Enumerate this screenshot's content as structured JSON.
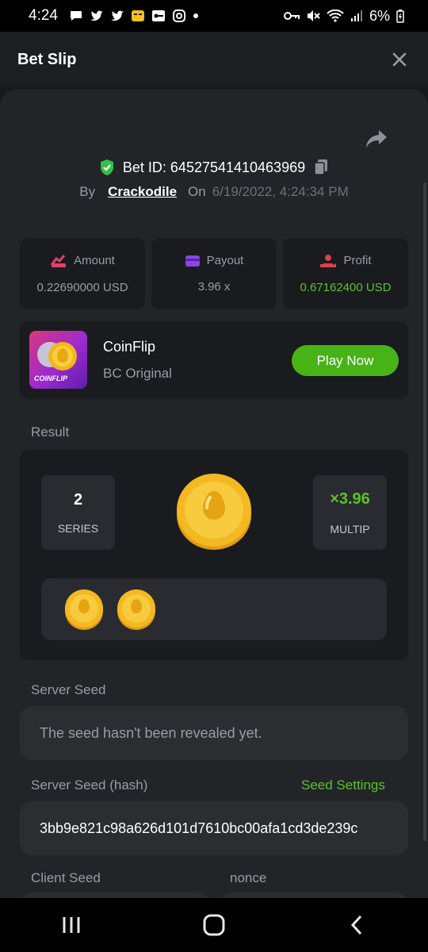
{
  "status_bar": {
    "time": "4:24",
    "battery": "6%"
  },
  "header": {
    "title": "Bet Slip"
  },
  "bet": {
    "id_label": "Bet ID:",
    "id": "64527541410463969",
    "by_label": "By",
    "user": "Crackodile",
    "on_label": "On",
    "datetime": "6/19/2022, 4:24:34 PM"
  },
  "stats": {
    "amount": {
      "label": "Amount",
      "value": "0.22690000 USD"
    },
    "payout": {
      "label": "Payout",
      "value": "3.96 x"
    },
    "profit": {
      "label": "Profit",
      "value": "0.67162400 USD"
    }
  },
  "game": {
    "name": "CoinFlip",
    "subtitle": "BC Original",
    "thumb_label": "COINFLIP",
    "play_label": "Play Now"
  },
  "result": {
    "label": "Result",
    "series_value": "2",
    "series_label": "SERIES",
    "multiplier_value": "×3.96",
    "multiplier_label": "MULTIP"
  },
  "server_seed": {
    "label": "Server Seed",
    "value": "The seed hasn't been revealed yet."
  },
  "server_seed_hash": {
    "label": "Server Seed (hash)",
    "settings_link": "Seed Settings",
    "value": "3bb9e821c98a626d101d7610bc00afa1cd3de239c"
  },
  "client_seed": {
    "label": "Client Seed"
  },
  "nonce": {
    "label": "nonce"
  },
  "colors": {
    "accent_green": "#47b316",
    "profit_green": "#5ac424",
    "background": "#17181b"
  }
}
